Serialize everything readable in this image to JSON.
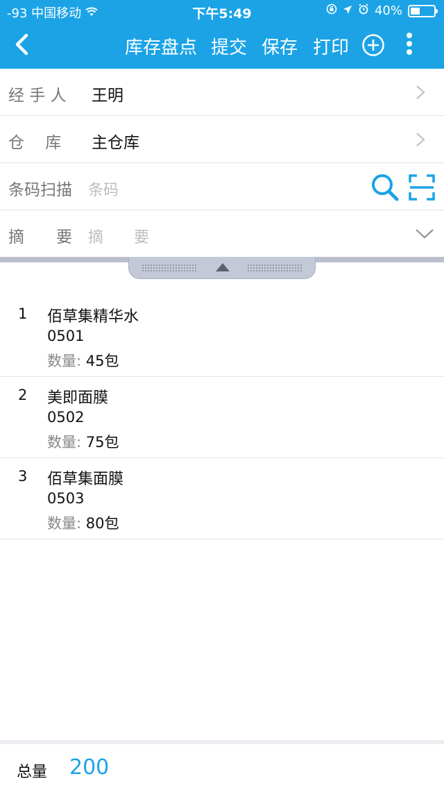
{
  "status_bar": {
    "carrier": "-93 中国移动",
    "time": "下午5:49",
    "battery": "40%",
    "battery_level": 0.4
  },
  "nav": {
    "back_icon": "chevron-left-icon",
    "title": "库存盘点",
    "submit": "提交",
    "save": "保存",
    "print": "打印",
    "add_icon": "plus-circle-icon",
    "more_icon": "more-vertical-icon"
  },
  "form": {
    "handler": {
      "label": "经 手 人",
      "value": "王明"
    },
    "warehouse": {
      "label": "仓　 库",
      "value": "主仓库"
    },
    "barcode": {
      "label": "条码扫描",
      "placeholder": "条码"
    },
    "summary": {
      "label": "摘　　要",
      "placeholder": "摘　　要"
    }
  },
  "items": [
    {
      "index": "1",
      "name": "佰草集精华水",
      "code": "0501",
      "qty_label": "数量:",
      "qty": "45包"
    },
    {
      "index": "2",
      "name": "美即面膜",
      "code": "0502",
      "qty_label": "数量:",
      "qty": "75包"
    },
    {
      "index": "3",
      "name": "佰草集面膜",
      "code": "0503",
      "qty_label": "数量:",
      "qty": "80包"
    }
  ],
  "footer": {
    "total_label": "总量",
    "total_value": "200"
  },
  "colors": {
    "accent": "#1ba3e6"
  }
}
